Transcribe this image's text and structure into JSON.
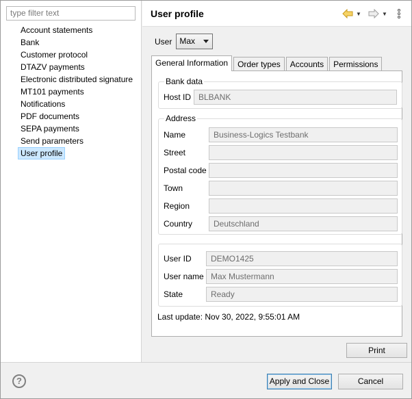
{
  "sidebar": {
    "filter_placeholder": "type filter text",
    "items": [
      {
        "label": "Account statements"
      },
      {
        "label": "Bank"
      },
      {
        "label": "Customer protocol"
      },
      {
        "label": "DTAZV payments"
      },
      {
        "label": "Electronic distributed signature"
      },
      {
        "label": "MT101 payments"
      },
      {
        "label": "Notifications"
      },
      {
        "label": "PDF documents"
      },
      {
        "label": "SEPA payments"
      },
      {
        "label": "Send parameters"
      },
      {
        "label": "User profile"
      }
    ],
    "selected": "User profile"
  },
  "header": {
    "title": "User profile",
    "icons": [
      "back-arrow-icon",
      "forward-arrow-icon",
      "view-menu-icon"
    ]
  },
  "user": {
    "label": "User",
    "selected": "Max"
  },
  "tabs": [
    {
      "label": "General Information",
      "active": true
    },
    {
      "label": "Order types"
    },
    {
      "label": "Accounts"
    },
    {
      "label": "Permissions"
    }
  ],
  "bank_data": {
    "legend": "Bank data",
    "host_id_label": "Host ID",
    "host_id": "BLBANK"
  },
  "address": {
    "legend": "Address",
    "name_label": "Name",
    "name": "Business-Logics Testbank",
    "street_label": "Street",
    "street": "",
    "postal_label": "Postal code",
    "postal": "",
    "town_label": "Town",
    "town": "",
    "region_label": "Region",
    "region": "",
    "country_label": "Country",
    "country": "Deutschland"
  },
  "account": {
    "user_id_label": "User ID",
    "user_id": "DEMO1425",
    "user_name_label": "User name",
    "user_name": "Max Mustermann",
    "state_label": "State",
    "state": "Ready"
  },
  "last_update": "Last update: Nov 30, 2022, 9:55:01 AM",
  "buttons": {
    "print": "Print",
    "apply_close": "Apply and Close",
    "cancel": "Cancel",
    "help": "?"
  }
}
